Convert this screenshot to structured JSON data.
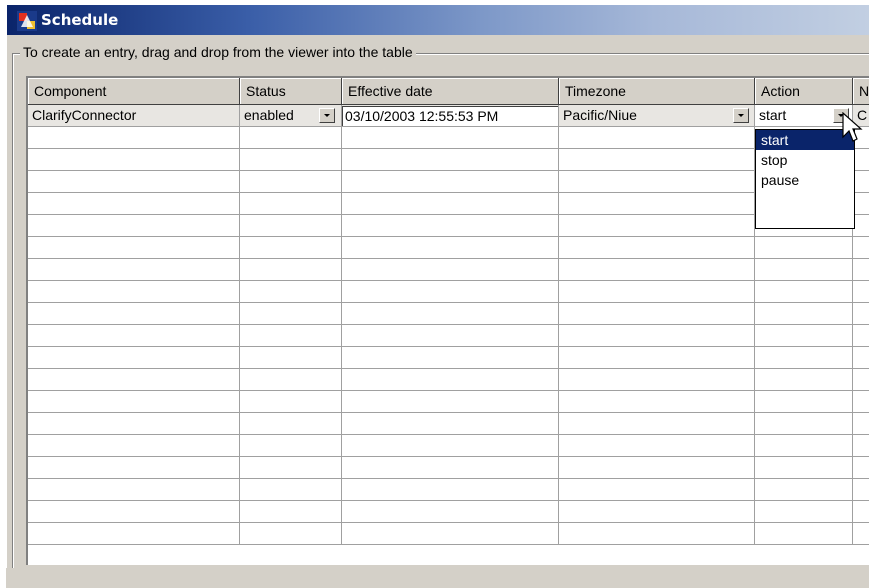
{
  "window": {
    "title": "Schedule",
    "icon": "app-icon"
  },
  "group": {
    "label": "To create an entry, drag and drop from the viewer into the table"
  },
  "table": {
    "columns": [
      "Component",
      "Status",
      "Effective date",
      "Timezone",
      "Action",
      "N"
    ],
    "rows": [
      {
        "component": "ClarifyConnector",
        "status": "enabled",
        "effective_date": "03/10/2003 12:55:53 PM",
        "timezone": "Pacific/Niue",
        "action": "start",
        "extra": "C"
      }
    ],
    "empty_rows": 19
  },
  "action_dropdown": {
    "options": [
      "start",
      "stop",
      "pause"
    ],
    "selected": "start"
  },
  "colors": {
    "title_start": "#0a246a",
    "title_end": "#c2cfe2",
    "face": "#d4d0c8",
    "selection": "#0a246a"
  }
}
